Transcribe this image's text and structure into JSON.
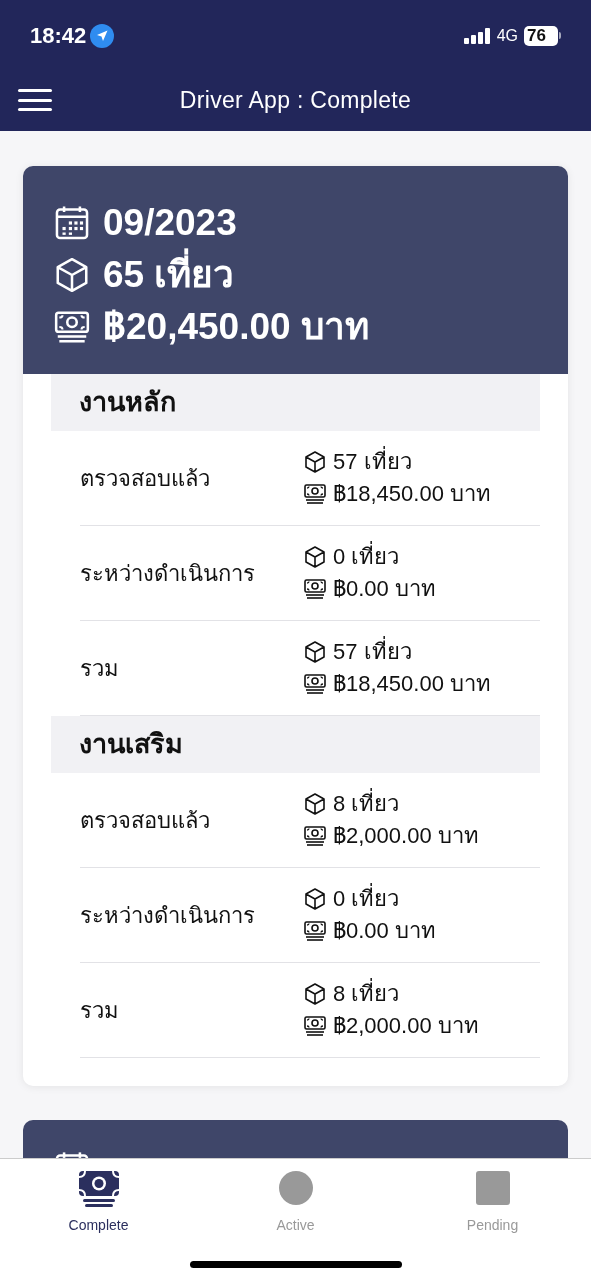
{
  "status_bar": {
    "time": "18:42",
    "network": "4G",
    "battery": "76"
  },
  "header": {
    "title": "Driver App : Complete"
  },
  "cards": [
    {
      "month": "09/2023",
      "trips": "65 เที่ยว",
      "amount": "฿20,450.00 บาท",
      "sections": [
        {
          "title": "งานหลัก",
          "rows": [
            {
              "label": "ตรวจสอบแล้ว",
              "trips": "57 เที่ยว",
              "amount": "฿18,450.00 บาท"
            },
            {
              "label": "ระหว่างดำเนินการ",
              "trips": "0 เที่ยว",
              "amount": "฿0.00 บาท"
            },
            {
              "label": "รวม",
              "trips": "57 เที่ยว",
              "amount": "฿18,450.00 บาท"
            }
          ]
        },
        {
          "title": "งานเสริม",
          "rows": [
            {
              "label": "ตรวจสอบแล้ว",
              "trips": "8 เที่ยว",
              "amount": "฿2,000.00 บาท"
            },
            {
              "label": "ระหว่างดำเนินการ",
              "trips": "0 เที่ยว",
              "amount": "฿0.00 บาท"
            },
            {
              "label": "รวม",
              "trips": "8 เที่ยว",
              "amount": "฿2,000.00 บาท"
            }
          ]
        }
      ]
    }
  ],
  "tabs": [
    {
      "label": "Complete",
      "selected": true,
      "kind": "money"
    },
    {
      "label": "Active",
      "selected": false,
      "kind": "circle"
    },
    {
      "label": "Pending",
      "selected": false,
      "kind": "square"
    }
  ]
}
